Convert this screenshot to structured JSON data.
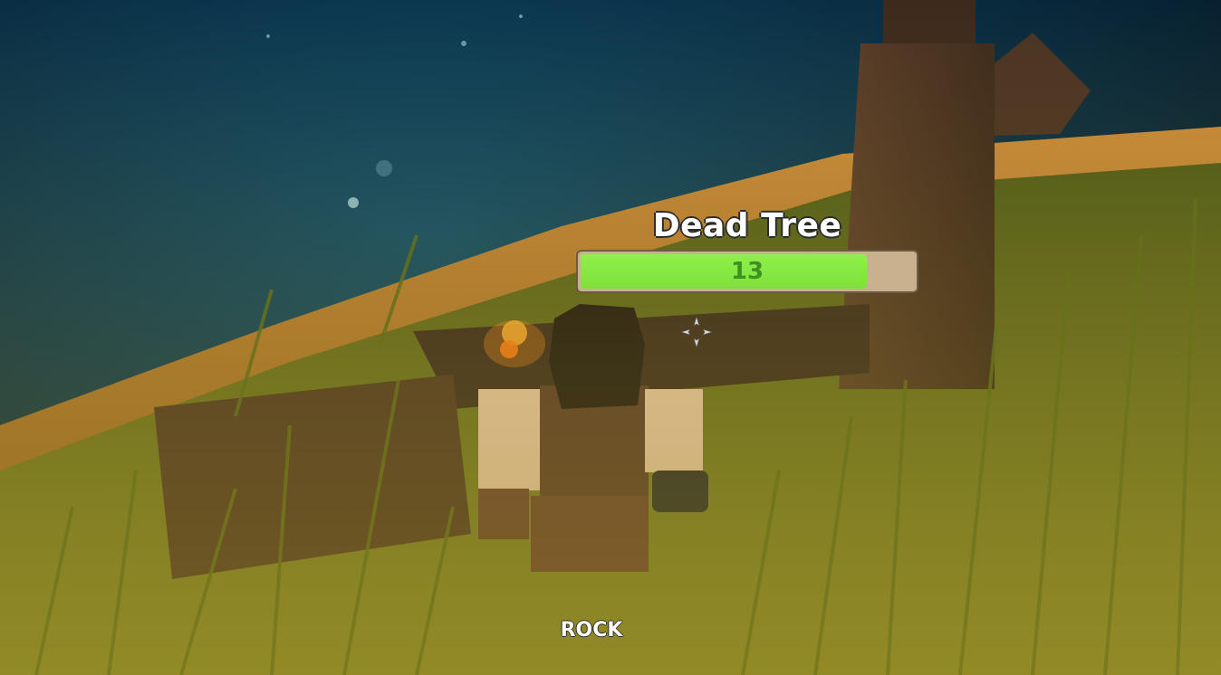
{
  "target": {
    "name": "Dead Tree",
    "health_value": "13",
    "health_fraction": 0.86
  },
  "hotbar": {
    "selected_tool": "ROCK"
  },
  "crosshair": {
    "icon": "crosshair-icon"
  },
  "colors": {
    "health_fill": "#7ee03a",
    "health_track": "#c9b08f",
    "ocean": "#0d2a3a",
    "grass": "#6b7a22"
  }
}
